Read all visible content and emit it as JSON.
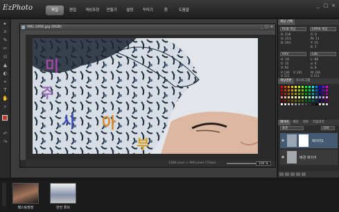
{
  "app": {
    "logo": "EzPhoto"
  },
  "menu": [
    "파일",
    "편집",
    "색상조정",
    "만들기",
    "설정",
    "꾸미기",
    "창",
    "도움말"
  ],
  "menu_active_index": 0,
  "window_controls": [
    "_",
    "□",
    "×"
  ],
  "tools": [
    "▸",
    "⌗",
    "✎",
    "✂",
    "⊙",
    "▲",
    "◐",
    "⌖",
    "T",
    "✋",
    "⌕",
    "↶",
    "↷"
  ],
  "document": {
    "title": "IMG-1956.jpg (RGB)",
    "controls": [
      "_",
      "□",
      "×"
    ],
    "status_size": "1280 pixel × 960 pixel (72dpi)",
    "zoom": "100 %",
    "overlay_text": [
      "미",
      "주",
      "사",
      "아",
      "부"
    ]
  },
  "color_panel": {
    "tabs": [
      "색상 선택"
    ],
    "left_mode": "RGB 색상",
    "right_mode": "CMYK 색상",
    "left_values": [
      "R: 236",
      "G: 211",
      "B: 201"
    ],
    "right_values": [
      "C: 0",
      "M: 11",
      "Y: 15",
      "K: 7"
    ],
    "mid_left_mode": "HSV",
    "mid_right_mode": "Lab",
    "mid_left_values": [
      "H: 16",
      "S: 15",
      "V: 92"
    ],
    "mid_right_values": [
      "L: 86",
      "a: 6",
      "b: 8"
    ],
    "hex_values": [
      "V: 236",
      "V: 211",
      "V: 201"
    ],
    "hex_right_values": [
      "W: 236",
      "V: 211"
    ]
  },
  "swatch_panel": {
    "tabs": [
      "색상견본",
      "히스토그램"
    ]
  },
  "palette": [
    "#ff0000",
    "#ff4000",
    "#ff8000",
    "#ffbf00",
    "#ffff00",
    "#bfff00",
    "#80ff00",
    "#00ff00",
    "#00ff80",
    "#00ffff",
    "#0080ff",
    "#0000ff",
    "#8000ff",
    "#ff00ff",
    "#cc0000",
    "#cc3300",
    "#cc6600",
    "#cc9900",
    "#cccc00",
    "#99cc00",
    "#66cc00",
    "#00cc00",
    "#00cc66",
    "#00cccc",
    "#0066cc",
    "#0000cc",
    "#6600cc",
    "#cc00cc",
    "#990000",
    "#992600",
    "#994d00",
    "#997300",
    "#999900",
    "#739900",
    "#4d9900",
    "#009900",
    "#00994d",
    "#009999",
    "#004d99",
    "#000099",
    "#4d0099",
    "#990099",
    "#ff9999",
    "#ffb399",
    "#ffcc99",
    "#ffe699",
    "#ffff99",
    "#e6ff99",
    "#ccff99",
    "#99ff99",
    "#99ffcc",
    "#99ffff",
    "#99ccff",
    "#9999ff",
    "#cc99ff",
    "#ff99ff",
    "#660000",
    "#661a00",
    "#663300",
    "#664d00",
    "#666600",
    "#4d6600",
    "#336600",
    "#006600",
    "#006633",
    "#006666",
    "#003366",
    "#000066",
    "#330066",
    "#660066",
    "#ffffff",
    "#e6e6e6",
    "#cccccc",
    "#b3b3b3",
    "#999999",
    "#808080",
    "#666666",
    "#4d4d4d",
    "#333333",
    "#1a1a1a",
    "#000000",
    "#ffcccc",
    "#ccffcc",
    "#ccccff"
  ],
  "layers_panel": {
    "tabs": [
      "레이어",
      "채널",
      "경로",
      "작업내역"
    ],
    "blend_mode": "표준",
    "opacity": "100",
    "layers": [
      {
        "name": "레이어1",
        "selected": true
      },
      {
        "name": "배경 레이어",
        "selected": false
      }
    ]
  },
  "filmstrip": [
    {
      "label": "페스팅정장",
      "colors": [
        "#6b4a3a",
        "#b58a6a",
        "#2a2a2a"
      ]
    },
    {
      "label": "한컨 꽃모",
      "colors": [
        "#ececec",
        "#7d8aa0",
        "#b0b0b0"
      ]
    }
  ]
}
